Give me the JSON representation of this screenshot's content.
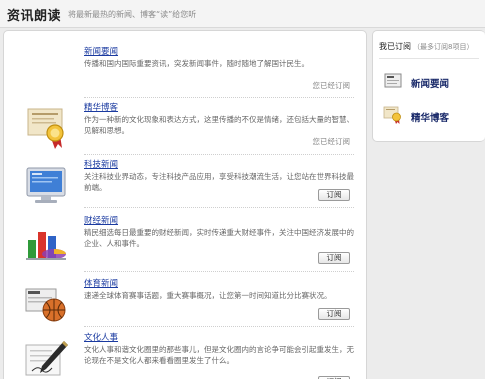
{
  "header": {
    "title": "资讯朗读",
    "subtitle": "将最新最热的新闻、博客“读”给您听"
  },
  "channels": [
    {
      "name": "新闻要闻",
      "desc": "传播和国内国际重要资讯，突发新闻事件，随时随地了解国计民生。",
      "status": "您已经订阅",
      "icon": "newspaper-icon"
    },
    {
      "name": "精华博客",
      "desc": "作为一种新的文化现象和表达方式，这里传播的不仅是情绪，还包括大量的智慧、见解和思想。",
      "status": "您已经订阅",
      "icon": "medal-icon"
    },
    {
      "name": "科技新闻",
      "desc": "关注科技业界动态，专注科技产品应用，享受科技潮流生活，让您站在世界科技最前端。",
      "button": "订阅",
      "icon": "monitor-icon"
    },
    {
      "name": "财经新闻",
      "desc": "精民细选每日最重要的财经新闻，实时传递重大财经事件，关注中国经济发展中的企业、人和事件。",
      "button": "订阅",
      "icon": "chart-icon"
    },
    {
      "name": "体育新闻",
      "desc": "速递全球体育赛事话题，重大赛事概况，让您第一时间知道比分比赛状况。",
      "button": "订阅",
      "icon": "basketball-icon"
    },
    {
      "name": "文化人事",
      "desc": "文化人事和谐文化圈里的那些事儿，但是文化圈内的言论争可能会引起重发生，无论现在不是文化人都来看看圈里发生了什么。",
      "button": "订阅",
      "icon": "pen-icon"
    }
  ],
  "sidebar": {
    "heading": "我已订阅",
    "count": "（最多订阅8项目）",
    "items": [
      {
        "label": "新闻要闻",
        "icon": "newspaper-icon"
      },
      {
        "label": "精华博客",
        "icon": "medal-icon"
      }
    ]
  },
  "colors": {
    "link": "#1a3aa0",
    "sidebar_label": "#1a2a6a",
    "background": "#ececec"
  }
}
